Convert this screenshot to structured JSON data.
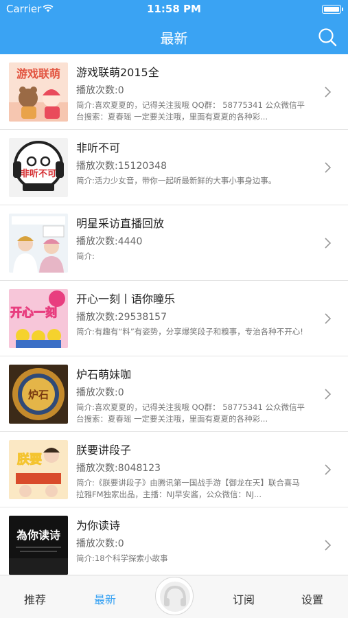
{
  "status": {
    "carrier": "Carrier",
    "time": "11:58 PM"
  },
  "nav": {
    "title": "最新",
    "search_icon": "search-icon"
  },
  "items": [
    {
      "title": "游戏联萌2015全",
      "plays_label": "播放次数:0",
      "desc": "简介:喜欢夏夏的，记得关注我哦 QQ群： 58775341 公众微信平台搜索：夏春瑶 一定要关注哦，里面有夏夏的各种彩...",
      "cover_text": "游戏联萌"
    },
    {
      "title": "非听不可",
      "plays_label": "播放次数:15120348",
      "desc": "简介:活力少女音，带你一起听最新鲜的大事小事身边事。",
      "cover_text": "非听不可"
    },
    {
      "title": "明星采访直播回放",
      "plays_label": "播放次数:4440",
      "desc": "简介:",
      "cover_text": ""
    },
    {
      "title": "开心一刻丨语你瞳乐",
      "plays_label": "播放次数:29538157",
      "desc": "简介:有趣有“料”有姿势，分享爆笑段子和糗事，专治各种不开心!",
      "cover_text": "开心一刻"
    },
    {
      "title": "炉石萌妹咖",
      "plays_label": "播放次数:0",
      "desc": "简介:喜欢夏夏的，记得关注我哦 QQ群： 58775341 公众微信平台搜索：夏春瑶 一定要关注哦，里面有夏夏的各种彩...",
      "cover_text": "炉石"
    },
    {
      "title": "朕要讲段子",
      "plays_label": "播放次数:8048123",
      "desc": "简介:《朕要讲段子》由腾讯第一国战手游【御龙在天】联合喜马拉雅FM独家出品，主播：NJ早安酱，公众微信：NJ...",
      "cover_text": "朕要"
    },
    {
      "title": "为你读诗",
      "plays_label": "播放次数:0",
      "desc": "简介:18个科学探索小故事",
      "cover_text": "為你读诗"
    }
  ],
  "tabs": [
    {
      "label": "推荐",
      "active": false
    },
    {
      "label": "最新",
      "active": true
    },
    {
      "label": "订阅",
      "active": false
    },
    {
      "label": "设置",
      "active": false
    }
  ],
  "center_button": {
    "icon": "headphones-icon"
  },
  "colors": {
    "accent": "#3aa3f3"
  }
}
